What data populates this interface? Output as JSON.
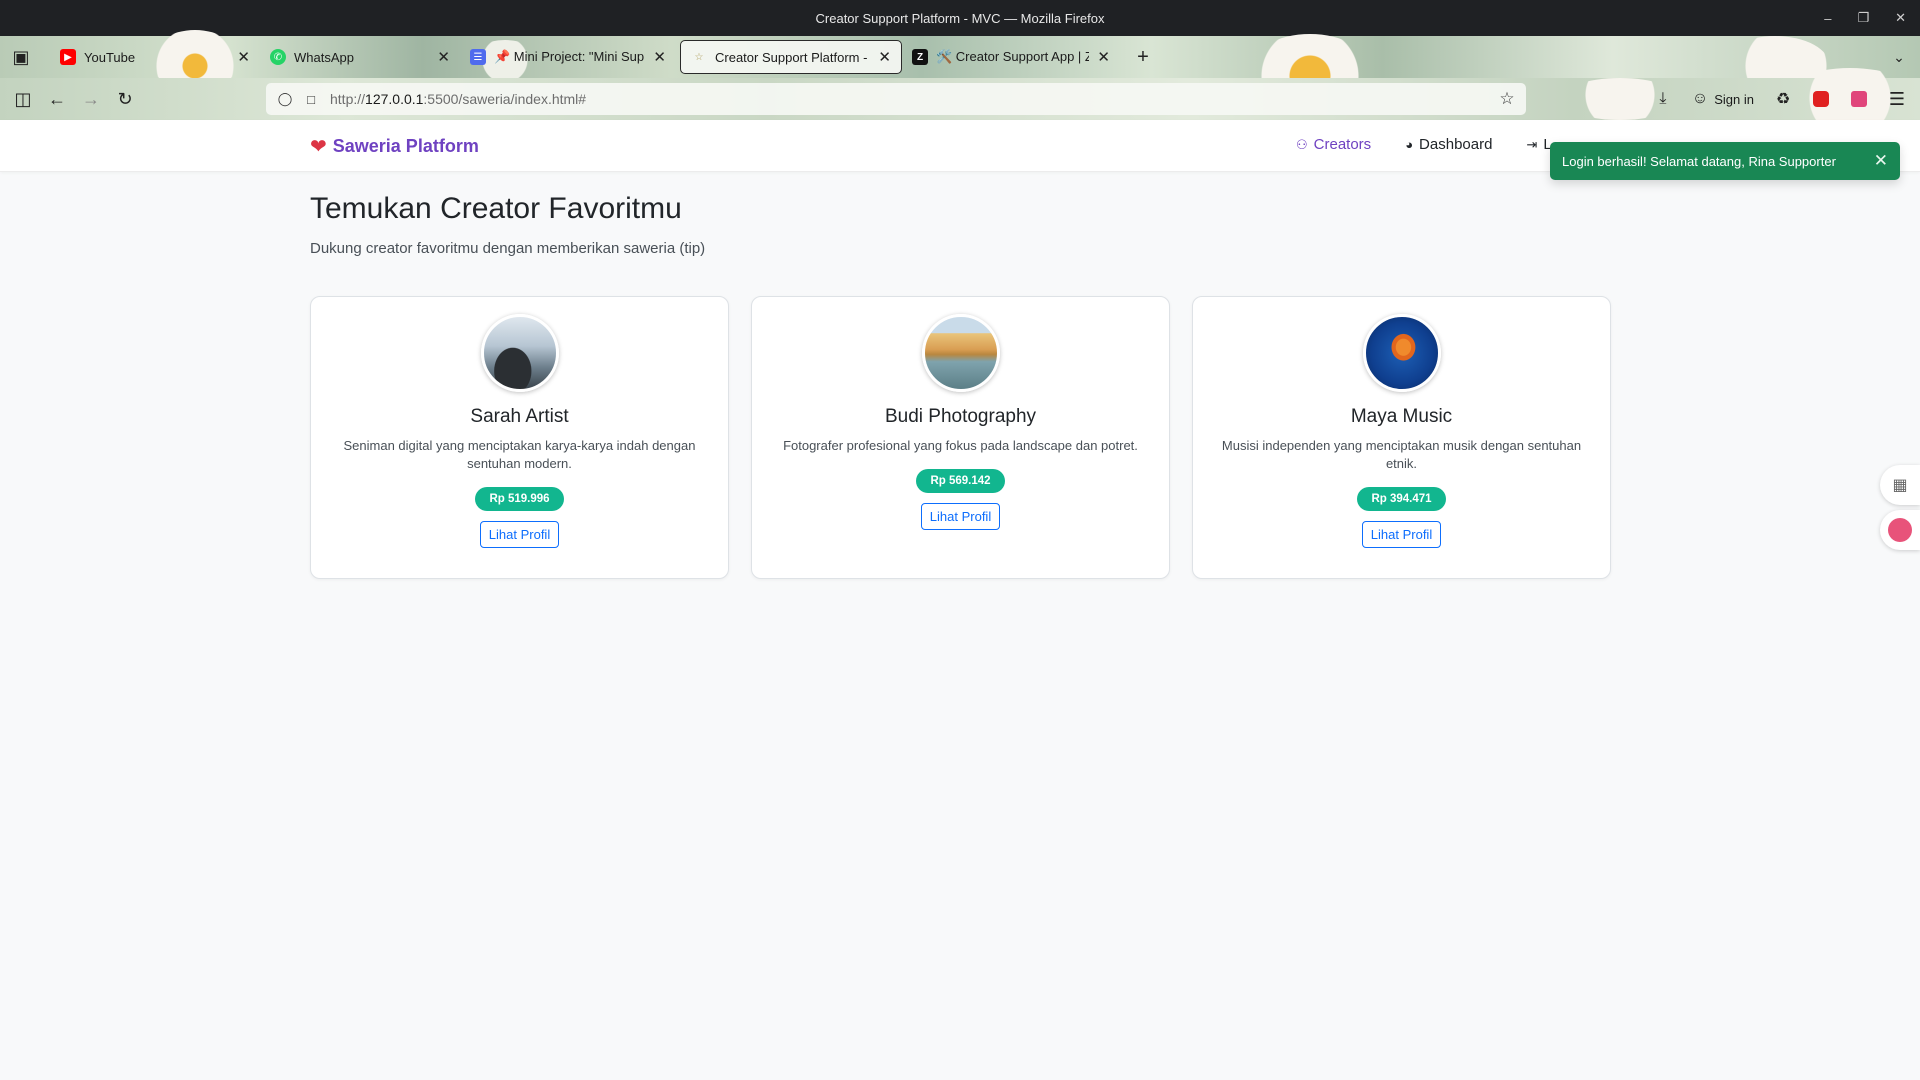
{
  "window": {
    "title": "Creator Support Platform - MVC — Mozilla Firefox"
  },
  "tabs": [
    {
      "label": "YouTube",
      "icon": "youtube-icon"
    },
    {
      "label": "WhatsApp",
      "icon": "whatsapp-icon"
    },
    {
      "label": "📌 Mini Project: \"Mini Supp",
      "icon": "docs-icon"
    },
    {
      "label": "Creator Support Platform - M",
      "icon": "star-icon"
    },
    {
      "label": "🛠️ Creator Support App | Z",
      "icon": "z-icon"
    }
  ],
  "urlbar": {
    "scheme": "http://",
    "host": "127.0.0.1",
    "path": ":5500/saweria/index.html#"
  },
  "toolbar": {
    "signin_label": "Sign in"
  },
  "app": {
    "brand": "Saweria Platform",
    "nav": {
      "creators": "Creators",
      "dashboard": "Dashboard",
      "logout_partial": "L"
    },
    "accent_color": "#6f42c1"
  },
  "toast": {
    "message": "Login berhasil! Selamat datang, Rina Supporter",
    "color": "#198754"
  },
  "page": {
    "title": "Temukan Creator Favoritmu",
    "subtitle": "Dukung creator favoritmu dengan memberikan saweria (tip)"
  },
  "creators": [
    {
      "name": "Sarah Artist",
      "description": "Seniman digital yang menciptakan karya-karya indah dengan sentuhan modern.",
      "total": "Rp 519.996",
      "button": "Lihat Profil"
    },
    {
      "name": "Budi Photography",
      "description": "Fotografer profesional yang fokus pada landscape dan potret.",
      "total": "Rp 569.142",
      "button": "Lihat Profil"
    },
    {
      "name": "Maya Music",
      "description": "Musisi independen yang menciptakan musik dengan sentuhan etnik.",
      "total": "Rp 394.471",
      "button": "Lihat Profil"
    }
  ]
}
